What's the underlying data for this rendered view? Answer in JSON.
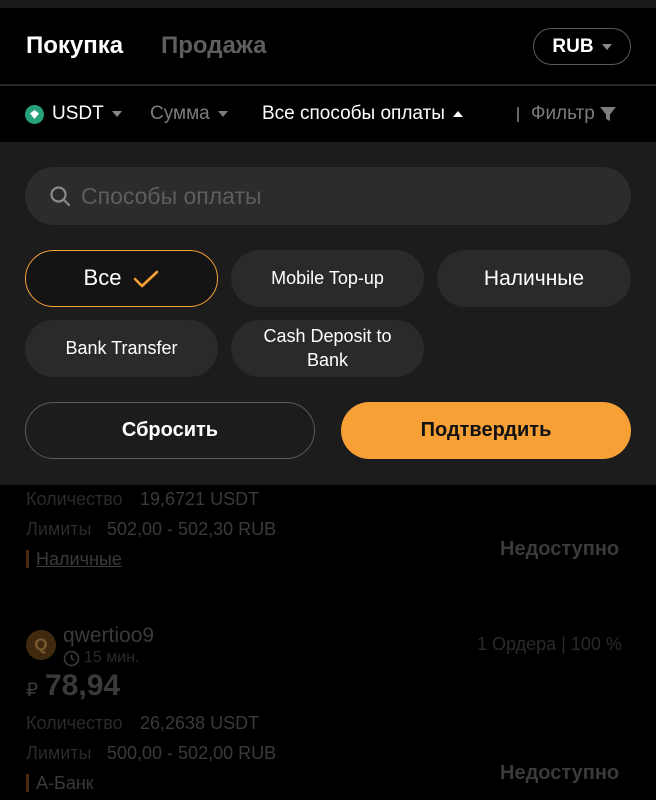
{
  "header": {
    "tab_buy": "Покупка",
    "tab_sell": "Продажа",
    "currency": "RUB"
  },
  "filterbar": {
    "coin": "USDT",
    "amount": "Сумма",
    "methods": "Все способы оплаты",
    "filter": "Фильтр"
  },
  "panel": {
    "search_placeholder": "Способы оплаты",
    "chips": [
      {
        "label": "Все",
        "selected": true
      },
      {
        "label": "Mobile Top-up",
        "selected": false
      },
      {
        "label": "Наличные",
        "selected": false
      },
      {
        "label": "Bank Transfer",
        "selected": false
      },
      {
        "label": "Cash Deposit to Bank",
        "selected": false
      }
    ],
    "reset_label": "Сбросить",
    "confirm_label": "Подтвердить"
  },
  "list": [
    {
      "quantity_label": "Количество",
      "quantity_value": "19,6721 USDT",
      "limits_label": "Лимиты",
      "limits_value": "502,00 - 502,30 RUB",
      "method": "Наличные",
      "status": "Недоступно"
    },
    {
      "avatar_letter": "Q",
      "name": "qwertioo9",
      "time": "15 мин.",
      "stats": "1 Ордера | 100 %",
      "currency_symbol": "₽",
      "price": "78,94",
      "quantity_label": "Количество",
      "quantity_value": "26,2638 USDT",
      "limits_label": "Лимиты",
      "limits_value": "500,00 - 502,00 RUB",
      "method": "А-Банк",
      "status": "Недоступно"
    }
  ],
  "colors": {
    "accent": "#f7a035",
    "panel_bg": "#1c1c1c",
    "chip_bg": "#2a2a2a",
    "coin": "#26a17b"
  }
}
